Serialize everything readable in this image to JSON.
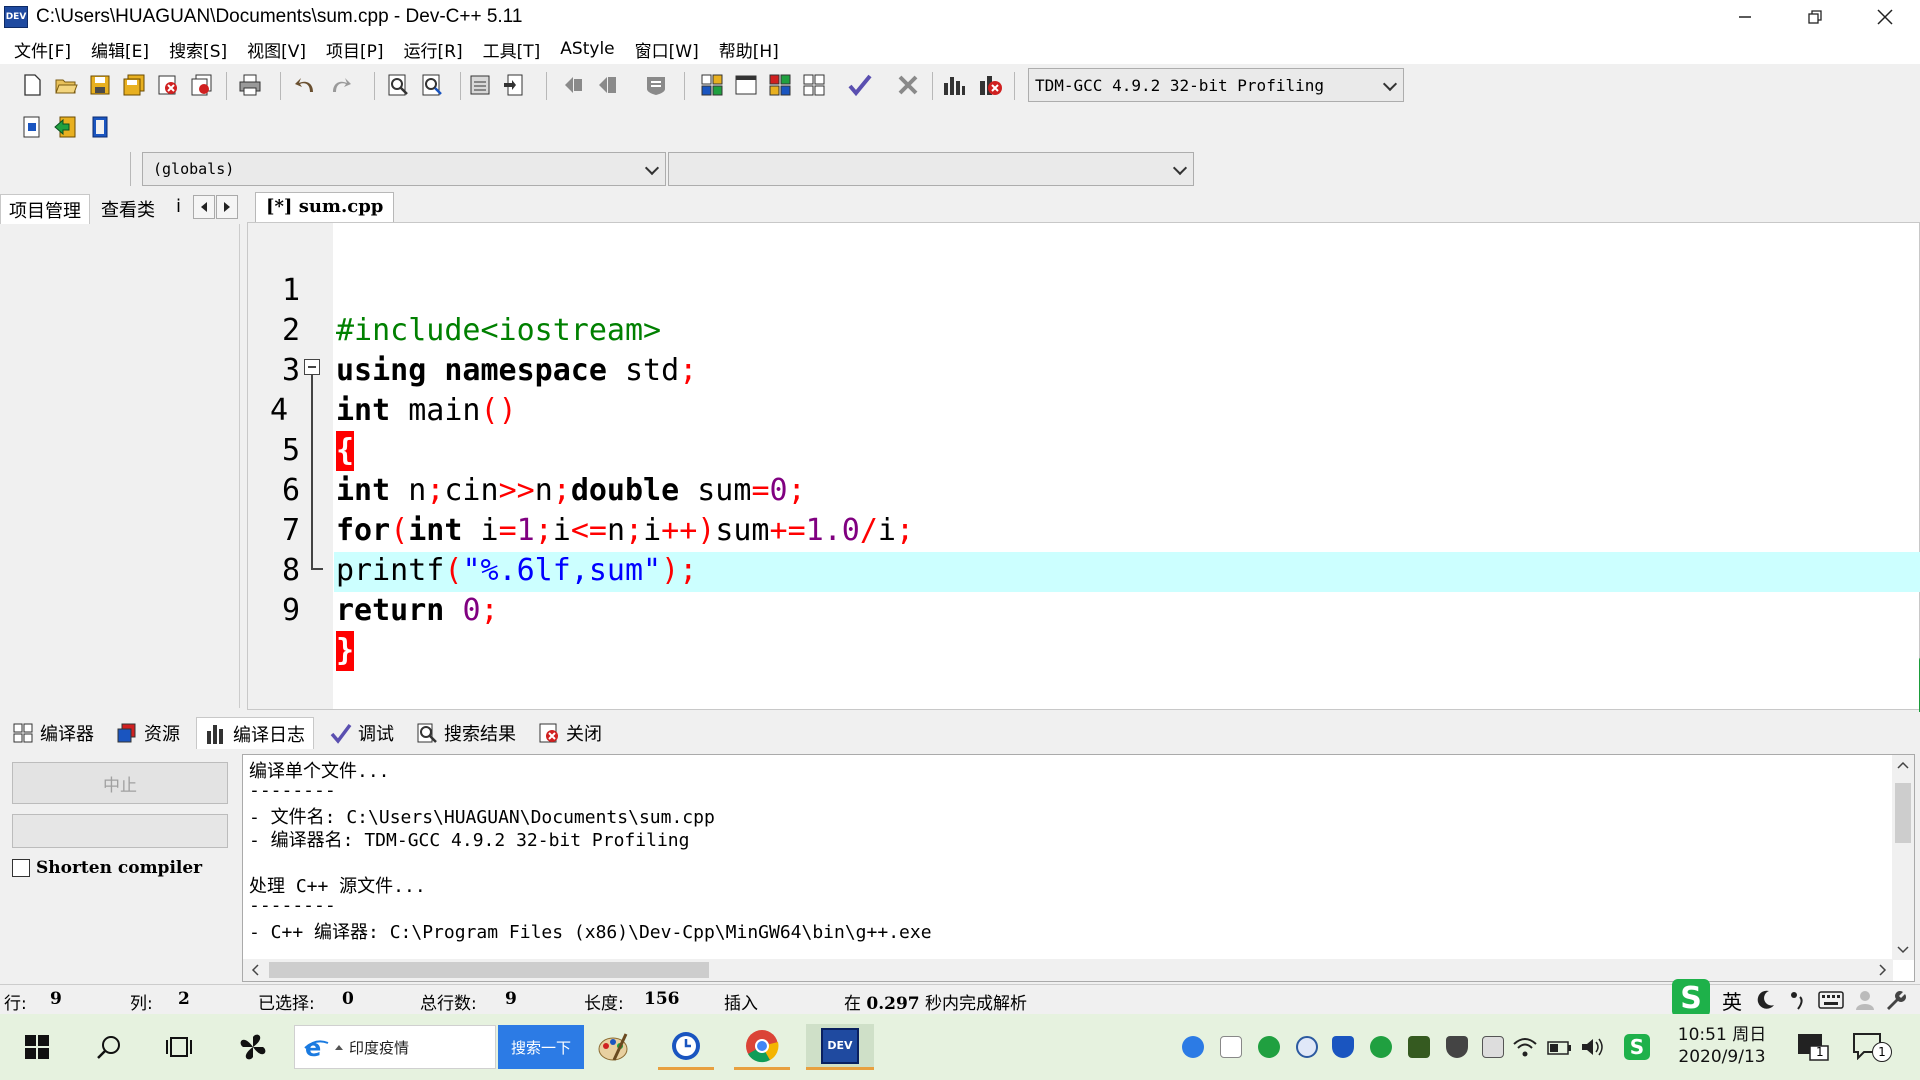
{
  "window": {
    "title": "C:\\Users\\HUAGUAN\\Documents\\sum.cpp - Dev-C++ 5.11",
    "app_icon_text": "DEV"
  },
  "menu": [
    "文件[F]",
    "编辑[E]",
    "搜索[S]",
    "视图[V]",
    "项目[P]",
    "运行[R]",
    "工具[T]",
    "AStyle",
    "窗口[W]",
    "帮助[H]"
  ],
  "toolbar": {
    "compiler_select": "TDM-GCC 4.9.2 32-bit Profiling"
  },
  "scope": {
    "class_select": "(globals)",
    "member_select": ""
  },
  "left_panel": {
    "tabs": [
      "项目管理",
      "查看类",
      "i"
    ]
  },
  "editor": {
    "tab_label": "[*] sum.cpp",
    "line_numbers": [
      "1",
      "2",
      "3",
      "4",
      "5",
      "6",
      "7",
      "8",
      "9"
    ],
    "lines": [
      "#include<iostream>",
      "using namespace std;",
      "int main()",
      "{",
      "int n;cin>>n;double sum=0;",
      "for(int i=1;i<=n;i++)sum+=1.0/i;",
      "printf(\"%.6lf,sum\");",
      "return 0;",
      "}"
    ]
  },
  "bottom_panel": {
    "tabs": [
      "编译器",
      "资源",
      "编译日志",
      "调试",
      "搜索结果",
      "关闭"
    ],
    "abort_label": "中止",
    "shorten_label": "Shorten compiler",
    "log": [
      "编译单个文件...",
      "--------",
      "- 文件名: C:\\Users\\HUAGUAN\\Documents\\sum.cpp",
      "- 编译器名: TDM-GCC 4.9.2 32-bit Profiling",
      "",
      "处理 C++ 源文件...",
      "--------",
      "- C++ 编译器: C:\\Program Files (x86)\\Dev-Cpp\\MinGW64\\bin\\g++.exe"
    ]
  },
  "status": {
    "row_label": "行:",
    "row": "9",
    "col_label": "列:",
    "col": "2",
    "sel_label": "已选择:",
    "sel": "0",
    "total_label": "总行数:",
    "total": "9",
    "len_label": "长度:",
    "len": "156",
    "mode": "插入",
    "parse_prefix": "在",
    "parse_time": "0.297",
    "parse_suffix": "秒内完成解析"
  },
  "taskbar": {
    "search_text": "印度疫情",
    "search_button": "搜索一下",
    "ime_lang": "英",
    "time": "10:51 周日",
    "date": "2020/9/13",
    "notification_count": "1"
  }
}
